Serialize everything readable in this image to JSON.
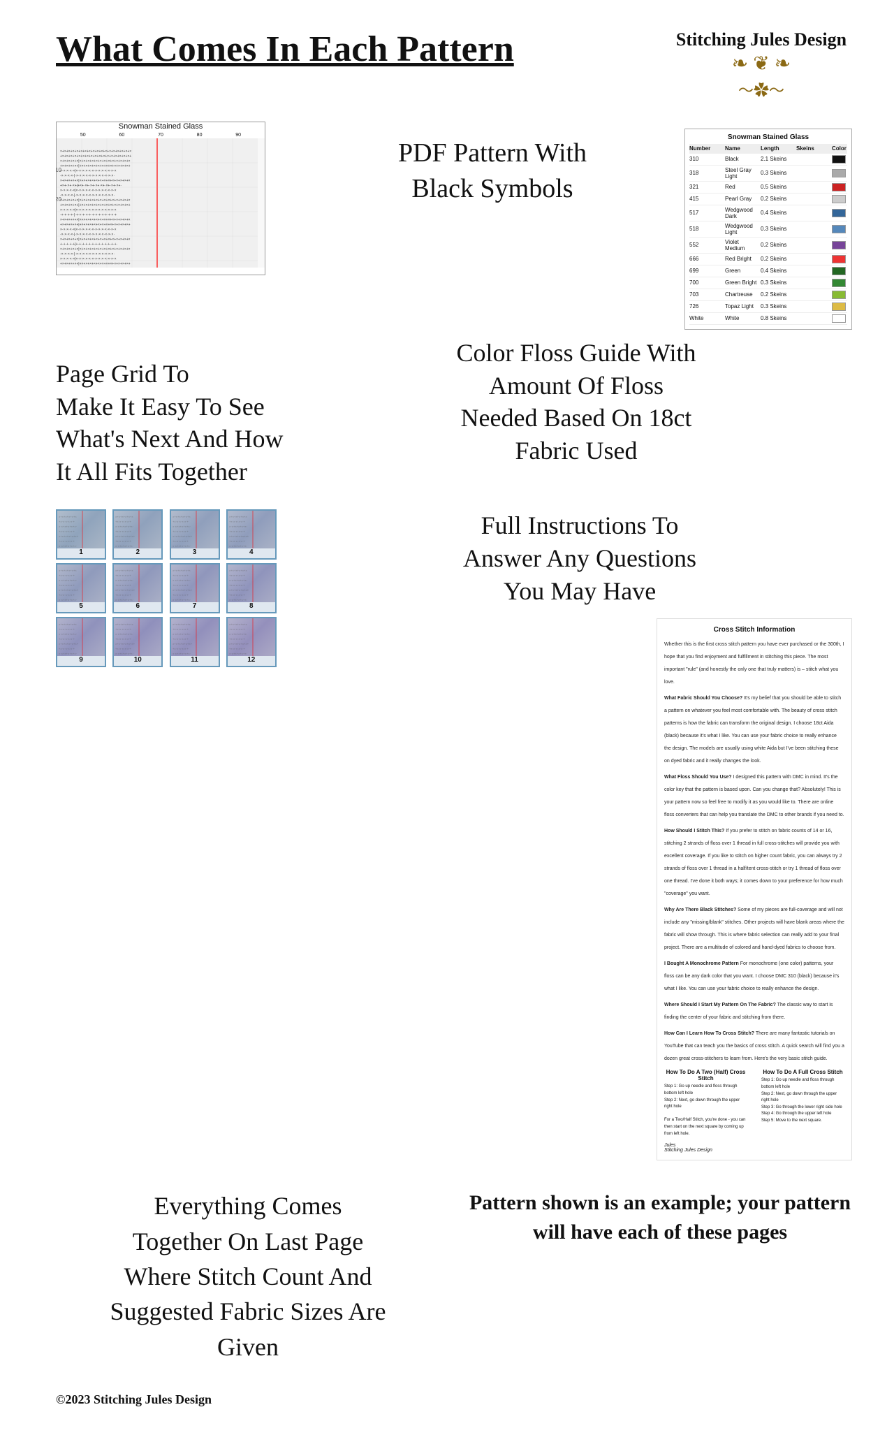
{
  "header": {
    "title": "What Comes In Each Pattern",
    "logo": {
      "line1": "Stitching Jules Design",
      "decoration": "❧❦❧"
    }
  },
  "features": [
    {
      "id": "pdf-pattern",
      "text": "PDF Pattern With\nBlack Symbols",
      "image_label": "cross_stitch_pattern"
    },
    {
      "id": "floss-guide",
      "text": "Color Floss Guide With\nAmount Of Floss\nNeeded Based On 18ct\nFabric Used",
      "image_label": "floss_guide_table"
    },
    {
      "id": "page-grid",
      "text": "Page Grid To\nMake It Easy To See\nWhat's Next And How\nIt All Fits Together",
      "image_label": "page_grid"
    },
    {
      "id": "full-instructions",
      "text": "Full Instructions To\nAnswer Any Questions\nYou May Have",
      "image_label": "instructions"
    },
    {
      "id": "stitch-count",
      "text": "Everything Comes\nTogether On Last Page\nWhere Stitch Count And\nSuggested Fabric Sizes Are\nGiven",
      "image_label": "last_page"
    },
    {
      "id": "pattern-note",
      "text": "Pattern shown is an example; your pattern will have each of these pages",
      "image_label": "note"
    }
  ],
  "pattern": {
    "title": "Snowman Stained Glass",
    "ruler_numbers": [
      "50",
      "60",
      "70",
      "80",
      "90"
    ]
  },
  "floss_table": {
    "title": "Snowman Stained Glass",
    "headers": [
      "Number",
      "Name",
      "Length",
      "Skeins"
    ],
    "rows": [
      {
        "number": "310",
        "name": "Black",
        "length": "2.1 Skeins",
        "color": "#111111"
      },
      {
        "number": "318",
        "name": "Steel Gray Light",
        "length": "0.3 Skeins",
        "color": "#aaaaaa"
      },
      {
        "number": "321",
        "name": "Red",
        "length": "0.5 Skeins",
        "color": "#cc2222"
      },
      {
        "number": "415",
        "name": "Pearl Gray",
        "length": "0.2 Skeins",
        "color": "#cccccc"
      },
      {
        "number": "517",
        "name": "Wedgwood Dark",
        "length": "0.4 Skeins",
        "color": "#336699"
      },
      {
        "number": "518",
        "name": "Wedgwood Light",
        "length": "0.3 Skeins",
        "color": "#5588bb"
      },
      {
        "number": "552",
        "name": "Violet Medium",
        "length": "0.2 Skeins",
        "color": "#774499"
      },
      {
        "number": "666",
        "name": "Red Bright",
        "length": "0.2 Skeins",
        "color": "#ee3333"
      },
      {
        "number": "699",
        "name": "Green",
        "length": "0.4 Skeins",
        "color": "#226622"
      },
      {
        "number": "700",
        "name": "Green Bright",
        "length": "0.3 Skeins",
        "color": "#338833"
      },
      {
        "number": "703",
        "name": "Chartreuse",
        "length": "0.2 Skeins",
        "color": "#88bb33"
      },
      {
        "number": "726",
        "name": "Topaz Light",
        "length": "0.3 Skeins",
        "color": "#ddbb44"
      },
      {
        "number": "White",
        "name": "White",
        "length": "0.8 Skeins",
        "color": "#ffffff"
      }
    ]
  },
  "cross_stitch_info": {
    "title": "Cross Stitch Information",
    "paragraphs": [
      {
        "heading": "",
        "text": "Whether this is the first cross stitch pattern you have ever purchased or the 300th, I hope that you find enjoyment and fulfillment in stitching this piece. The most important \"rule\" (and honestly the only one that truly matters) is – stitch what you love."
      },
      {
        "heading": "What Fabric Should You Choose?",
        "text": "It's my belief that you should be able to stitch a pattern on whatever you feel most comfortable with. The beauty of cross stitch patterns is how the fabric can transform the original design. I choose 18ct Aida (black) because it's what I like. You can use your fabric choice to really enhance the design. The models are usually using white Aida but I've been stitching these on dyed fabric and it really changes the look."
      },
      {
        "heading": "What Floss Should You Use?",
        "text": "I designed this pattern with DMC in mind. It's the color key that the pattern is based upon. Can you change that? Absolutely! This is your pattern now so feel free to modify it as you would like to. There are online floss converters that can help you translate the DMC to other brands if you need to."
      },
      {
        "heading": "How Should I Stitch This?",
        "text": "If you prefer to stitch on fabric counts of 14 or 16, stitching 2 strands of floss over 1 thread in full cross-stitches will provide you with excellent coverage. If you like to stitch on higher count fabric, you can always try 2 strands of floss over 1 thread in a half/tent cross-stitch or try 1 thread of floss over one thread. I've done it both ways; it comes down to your preference for how much \"coverage\" you want."
      },
      {
        "heading": "Why Are There Black Stitches?",
        "text": "Some of my pieces are full-coverage and will not include any \"missing/blank\" stitches. Other projects will have blank areas where the fabric will show through. This is where fabric selection can really add to your final project. There are a multitude of colored and hand-dyed fabrics to choose from."
      },
      {
        "heading": "I Bought A Monochrome Pattern",
        "text": "For monochrome (one color) patterns, your floss can be any dark color that you want. I choose DMC 310 (black) because it's what I like. You can use your fabric choice to really enhance the design."
      },
      {
        "heading": "Where Should I Start My Pattern On The Fabric?",
        "text": "The classic way to start is finding the center of your fabric and stitching from there."
      },
      {
        "heading": "How Can I Learn How To Cross Stitch?",
        "text": "There are many fantastic tutorials on YouTube that can teach you the basics of cross stitch. A quick search will find you a dozen great cross-stitchers to learn from. Here's the very basic stitch guide."
      }
    ],
    "how_to": {
      "col1_title": "How To Do A Two (Half) Cross Stitch",
      "col1_steps": [
        "Step 1: Go up needle and floss through bottom left hole",
        "Step 2: Next, go down through the upper right hole",
        "",
        "For a Two/Half Stitch, you're done - you can then start on the next square by coming up from left hole."
      ],
      "col2_title": "How To Do A Full Cross Stitch",
      "col2_steps": [
        "Step 1: Go up needle and floss through bottom left hole",
        "Step 2: Next, go down through the upper right hole",
        "Step 3: Go through the lower right side hole",
        "Step 4: Go through the upper left hole",
        "Step 5: Move to the next square."
      ]
    },
    "signature": "Jules\nStitching Jules Design"
  },
  "grid_pages": {
    "cells": [
      {
        "num": "1"
      },
      {
        "num": "2"
      },
      {
        "num": "3"
      },
      {
        "num": "4"
      },
      {
        "num": "5"
      },
      {
        "num": "6"
      },
      {
        "num": "7"
      },
      {
        "num": "8"
      },
      {
        "num": "9"
      },
      {
        "num": "10"
      },
      {
        "num": "11"
      },
      {
        "num": "12"
      }
    ]
  },
  "footer": {
    "copyright": "©2023 Stitching Jules Design"
  }
}
